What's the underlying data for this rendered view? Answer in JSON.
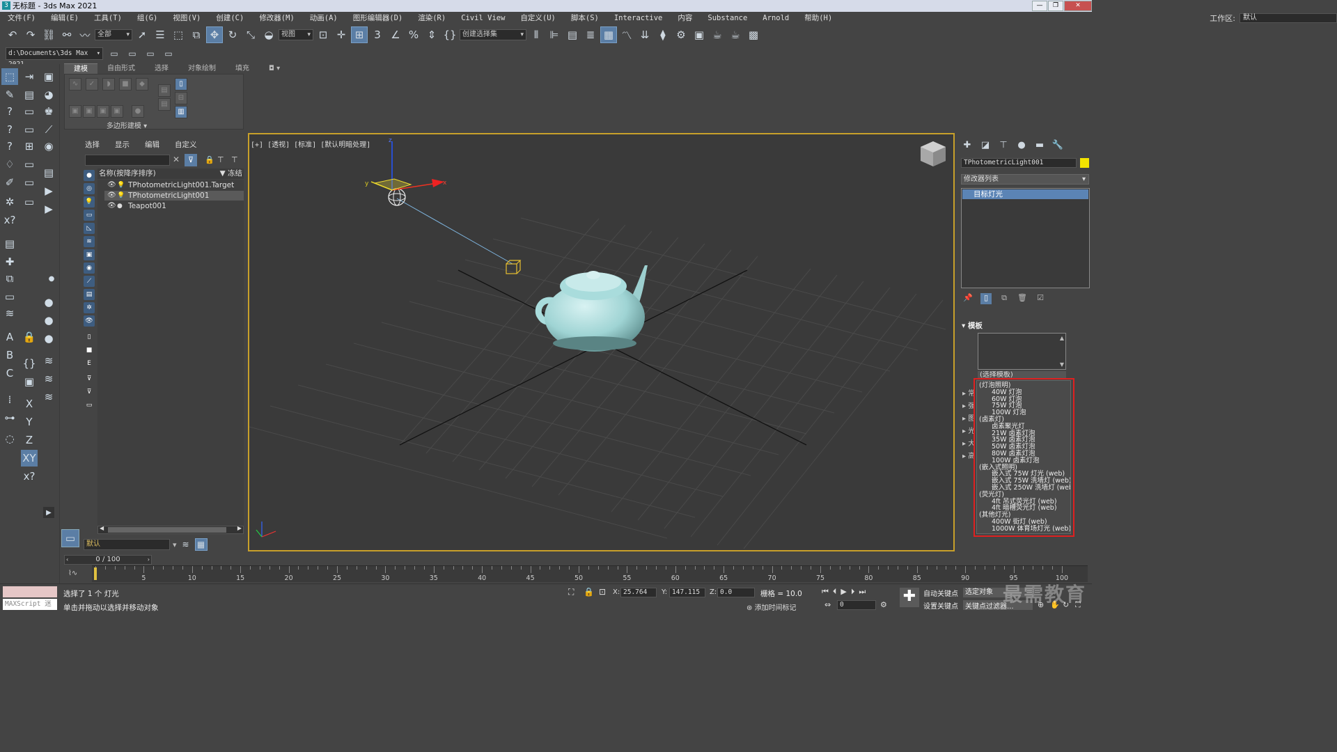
{
  "window": {
    "title": "无标题 - 3ds Max 2021",
    "controls": [
      "—",
      "❐",
      "✕"
    ]
  },
  "menu": [
    "文件(F)",
    "编辑(E)",
    "工具(T)",
    "组(G)",
    "视图(V)",
    "创建(C)",
    "修改器(M)",
    "动画(A)",
    "图形编辑器(D)",
    "渲染(R)",
    "Civil View",
    "自定义(U)",
    "脚本(S)",
    "Interactive",
    "内容",
    "Substance",
    "Arnold",
    "帮助(H)"
  ],
  "workspace": {
    "label": "工作区:",
    "value": "默认"
  },
  "toolbar": {
    "filter": "全部",
    "ref_coord": "视图",
    "selection_set": "创建选择集"
  },
  "project_path": "d:\\Documents\\3ds Max 2021",
  "ribbon": {
    "tabs": [
      "建模",
      "自由形式",
      "选择",
      "对象绘制",
      "填充"
    ],
    "active_tab": "建模",
    "group_label": "多边形建模"
  },
  "left_axis_labels": [
    "X",
    "Y",
    "Z",
    "XY"
  ],
  "scene_explorer": {
    "menu": [
      "选择",
      "显示",
      "编辑",
      "自定义"
    ],
    "header": "名称(按降序排序)",
    "frozen_col": "▼ 冻结",
    "rows": [
      "TPhotometricLight001.Target",
      "TPhotometricLight001",
      "Teapot001"
    ],
    "selected_row": 1,
    "layer": "默认"
  },
  "viewport": {
    "label": "[+] [透视] [标准] [默认明暗处理]"
  },
  "command_panel": {
    "object_name": "TPhotometricLight001",
    "object_color": "#f4e400",
    "modifier_list": "修改器列表",
    "stack_item": "目标灯光",
    "rollout_title": "模板",
    "template_select": "(选择模板)",
    "dropdown": [
      {
        "text": "(灯泡照明)",
        "sub": false
      },
      {
        "text": "40W 灯泡",
        "sub": true
      },
      {
        "text": "60W 灯泡",
        "sub": true
      },
      {
        "text": "75W 灯泡",
        "sub": true
      },
      {
        "text": "100W 灯泡",
        "sub": true
      },
      {
        "text": "(卤素灯)",
        "sub": false
      },
      {
        "text": "卤素聚光灯",
        "sub": true
      },
      {
        "text": "21W 卤素灯泡",
        "sub": true
      },
      {
        "text": "35W 卤素灯泡",
        "sub": true
      },
      {
        "text": "50W 卤素灯泡",
        "sub": true
      },
      {
        "text": "80W 卤素灯泡",
        "sub": true
      },
      {
        "text": "100W 卤素灯泡",
        "sub": true
      },
      {
        "text": "(嵌入式照明)",
        "sub": false
      },
      {
        "text": "嵌入式 75W 灯光 (web)",
        "sub": true
      },
      {
        "text": "嵌入式 75W 洗墙灯 (web)",
        "sub": true
      },
      {
        "text": "嵌入式 250W 洗墙灯 (web)",
        "sub": true
      },
      {
        "text": "(荧光灯)",
        "sub": false
      },
      {
        "text": "4ft 吊式荧光灯 (web)",
        "sub": true
      },
      {
        "text": "4ft 暗槽荧光灯 (web)",
        "sub": true
      },
      {
        "text": "(其他灯光)",
        "sub": false
      },
      {
        "text": "400W 街灯 (web)",
        "sub": true
      },
      {
        "text": "1000W 体育场灯光 (web)",
        "sub": true
      }
    ],
    "side_rollouts": [
      "常",
      "强",
      "图",
      "光",
      "大",
      "高"
    ]
  },
  "timeline": {
    "slider": "0 / 100",
    "ticks": [
      5,
      10,
      15,
      20,
      25,
      30,
      35,
      40,
      45,
      50,
      55,
      60,
      65,
      70,
      75,
      80,
      85,
      90,
      95,
      100
    ]
  },
  "status": {
    "maxscript": "MAXScript 迷",
    "selection": "选择了 1 个 灯光",
    "prompt": "单击并拖动以选择并移动对象",
    "x": "25.764",
    "y": "147.115",
    "z": "0.0",
    "grid": "栅格 = 10.0",
    "add_time_tag": "添加时间标记",
    "auto_key": "自动关键点",
    "set_key": "设置关键点",
    "selected_obj": "选定对象",
    "key_filter": "关键点过滤器...",
    "frame": "0",
    "watermark": "最需教育"
  }
}
